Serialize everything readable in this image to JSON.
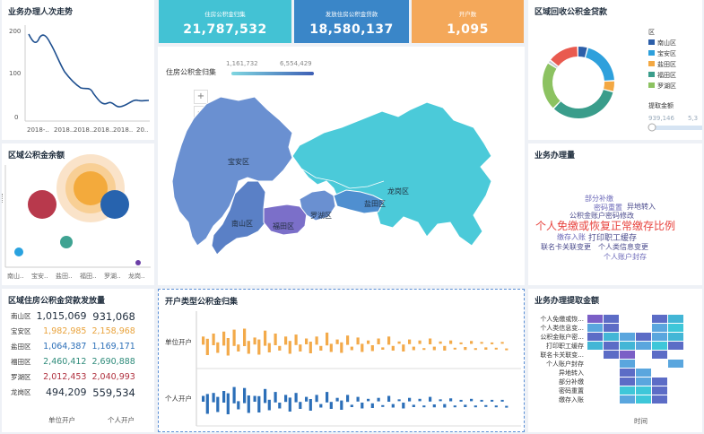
{
  "trend": {
    "title": "业务办理人次走势",
    "y_ticks": [
      "200",
      "100",
      "0"
    ],
    "x_ticks": [
      "2018-..",
      "2018..",
      "2018..",
      "2018..",
      "2018..",
      "20.."
    ]
  },
  "kpis": [
    {
      "label": "住房公积金归集",
      "value": "21,787,532",
      "color": "#43c2d4"
    },
    {
      "label": "发放住房公积金贷款",
      "value": "18,580,137",
      "color": "#3a86c8"
    },
    {
      "label": "开户数",
      "value": "1,095",
      "color": "#f4a85a"
    }
  ],
  "map": {
    "legend_label": "住房公积金归集",
    "range_min": "1,161,732",
    "range_max": "6,554,429",
    "zoom_in": "+",
    "zoom_out": "−",
    "districts": [
      "宝安区",
      "南山区",
      "福田区",
      "罗湖区",
      "盐田区",
      "龙岗区"
    ]
  },
  "recovery": {
    "title": "区域回收公积金贷款",
    "legend_title": "区",
    "legend": [
      {
        "name": "南山区",
        "color": "#2c5ea8"
      },
      {
        "name": "宝安区",
        "color": "#2ea0dc"
      },
      {
        "name": "盐田区",
        "color": "#f3a843"
      },
      {
        "name": "福田区",
        "color": "#3a9d8b"
      },
      {
        "name": "罗湖区",
        "color": "#8cc261"
      }
    ],
    "amount_label": "提取金额",
    "amount_min": "939,146",
    "amount_max": "5,3"
  },
  "balance": {
    "title": "区域公积金余额",
    "x_ticks": [
      "南山..",
      "宝安..",
      "盐田..",
      "福田..",
      "罗湖..",
      "龙岗.."
    ]
  },
  "business": {
    "title": "业务办理量",
    "words": [
      {
        "text": "部分补缴",
        "color": "#6b68b8",
        "size": 8
      },
      {
        "text": "密码重置",
        "color": "#6b68b8",
        "size": 8
      },
      {
        "text": "异地转入",
        "color": "#4a4a8c",
        "size": 8
      },
      {
        "text": "公积金账户密码修改",
        "color": "#4a4a8c",
        "size": 8
      },
      {
        "text": "个人免缴或恢复正常缴存比例",
        "color": "#e8443f",
        "size": 12
      },
      {
        "text": "缴存入账",
        "color": "#6b68b8",
        "size": 8
      },
      {
        "text": "打印职工缓存",
        "color": "#4a4a8c",
        "size": 9
      },
      {
        "text": "联名卡关联变更",
        "color": "#4a4a8c",
        "size": 8
      },
      {
        "text": "个人类信息变更",
        "color": "#4a4a8c",
        "size": 8
      },
      {
        "text": "个人账户封存",
        "color": "#6b68b8",
        "size": 8
      }
    ]
  },
  "loans": {
    "title": "区域住房公积金贷款发放量",
    "rows": [
      {
        "region": "南山区",
        "a": "1,015,069",
        "b": "931,068",
        "ca": "#1f2d3d",
        "cb": "#1f2d3d"
      },
      {
        "region": "宝安区",
        "a": "1,982,985",
        "b": "2,158,968",
        "ca": "#e9a33c",
        "cb": "#e9a33c"
      },
      {
        "region": "盐田区",
        "a": "1,064,387",
        "b": "1,169,171",
        "ca": "#2c6fb8",
        "cb": "#2c6fb8"
      },
      {
        "region": "福田区",
        "a": "2,460,412",
        "b": "2,690,888",
        "ca": "#2e8b7a",
        "cb": "#2e8b7a"
      },
      {
        "region": "罗湖区",
        "a": "2,012,453",
        "b": "2,040,993",
        "ca": "#b0313f",
        "cb": "#b0313f"
      },
      {
        "region": "龙岗区",
        "a": "494,209",
        "b": "559,534",
        "ca": "#1f2d3d",
        "cb": "#1f2d3d"
      }
    ],
    "col_a": "单位开户",
    "col_b": "个人开户"
  },
  "open_type": {
    "title": "开户类型公积金归集",
    "row1": "单位开户",
    "row2": "个人开户",
    "color1": "#f3aa4a",
    "color2": "#2c6fb8"
  },
  "withdraw": {
    "title": "业务办理提取金额",
    "rows": [
      "个人免缴或恢...",
      "个人类信息变...",
      "公积金账户密...",
      "打印职工缓存",
      "联名卡关联变...",
      "个人账户封存",
      "异地转入",
      "部分补缴",
      "密码重置",
      "缴存入账"
    ],
    "x_label": "时间"
  }
}
